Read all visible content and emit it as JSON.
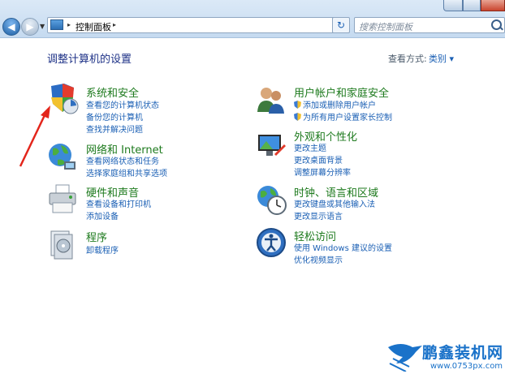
{
  "address": {
    "path_label": "控制面板",
    "search_placeholder": "搜索控制面板"
  },
  "header": {
    "title": "调整计算机的设置",
    "view_by_label": "查看方式:",
    "view_by_value": "类别 ▾"
  },
  "categories_left": [
    {
      "title": "系统和安全",
      "links": [
        "查看您的计算机状态",
        "备份您的计算机",
        "查找并解决问题"
      ]
    },
    {
      "title": "网络和 Internet",
      "links": [
        "查看网络状态和任务",
        "选择家庭组和共享选项"
      ]
    },
    {
      "title": "硬件和声音",
      "links": [
        "查看设备和打印机",
        "添加设备"
      ]
    },
    {
      "title": "程序",
      "links": [
        "卸载程序"
      ]
    }
  ],
  "categories_right": [
    {
      "title": "用户帐户和家庭安全",
      "links": [
        "添加或删除用户帐户",
        "为所有用户设置家长控制"
      ]
    },
    {
      "title": "外观和个性化",
      "links": [
        "更改主题",
        "更改桌面背景",
        "调整屏幕分辨率"
      ]
    },
    {
      "title": "时钟、语言和区域",
      "links": [
        "更改键盘或其他输入法",
        "更改显示语言"
      ]
    },
    {
      "title": "轻松访问",
      "links": [
        "使用 Windows 建议的设置",
        "优化视频显示"
      ]
    }
  ],
  "watermark": {
    "text": "鹏鑫装机网",
    "url": "www.0753px.com"
  }
}
